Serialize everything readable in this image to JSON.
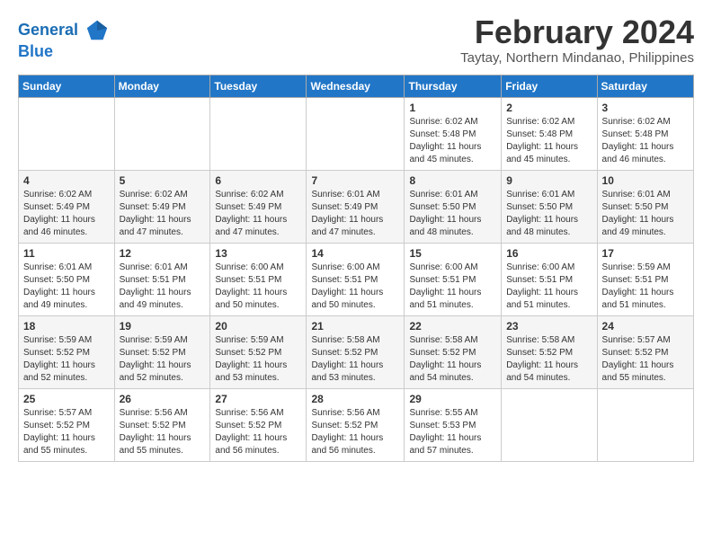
{
  "header": {
    "logo_line1": "General",
    "logo_line2": "Blue",
    "month_title": "February 2024",
    "location": "Taytay, Northern Mindanao, Philippines"
  },
  "days_of_week": [
    "Sunday",
    "Monday",
    "Tuesday",
    "Wednesday",
    "Thursday",
    "Friday",
    "Saturday"
  ],
  "weeks": [
    [
      {
        "day": "",
        "sunrise": "",
        "sunset": "",
        "daylight": ""
      },
      {
        "day": "",
        "sunrise": "",
        "sunset": "",
        "daylight": ""
      },
      {
        "day": "",
        "sunrise": "",
        "sunset": "",
        "daylight": ""
      },
      {
        "day": "",
        "sunrise": "",
        "sunset": "",
        "daylight": ""
      },
      {
        "day": "1",
        "sunrise": "Sunrise: 6:02 AM",
        "sunset": "Sunset: 5:48 PM",
        "daylight": "Daylight: 11 hours and 45 minutes."
      },
      {
        "day": "2",
        "sunrise": "Sunrise: 6:02 AM",
        "sunset": "Sunset: 5:48 PM",
        "daylight": "Daylight: 11 hours and 45 minutes."
      },
      {
        "day": "3",
        "sunrise": "Sunrise: 6:02 AM",
        "sunset": "Sunset: 5:48 PM",
        "daylight": "Daylight: 11 hours and 46 minutes."
      }
    ],
    [
      {
        "day": "4",
        "sunrise": "Sunrise: 6:02 AM",
        "sunset": "Sunset: 5:49 PM",
        "daylight": "Daylight: 11 hours and 46 minutes."
      },
      {
        "day": "5",
        "sunrise": "Sunrise: 6:02 AM",
        "sunset": "Sunset: 5:49 PM",
        "daylight": "Daylight: 11 hours and 47 minutes."
      },
      {
        "day": "6",
        "sunrise": "Sunrise: 6:02 AM",
        "sunset": "Sunset: 5:49 PM",
        "daylight": "Daylight: 11 hours and 47 minutes."
      },
      {
        "day": "7",
        "sunrise": "Sunrise: 6:01 AM",
        "sunset": "Sunset: 5:49 PM",
        "daylight": "Daylight: 11 hours and 47 minutes."
      },
      {
        "day": "8",
        "sunrise": "Sunrise: 6:01 AM",
        "sunset": "Sunset: 5:50 PM",
        "daylight": "Daylight: 11 hours and 48 minutes."
      },
      {
        "day": "9",
        "sunrise": "Sunrise: 6:01 AM",
        "sunset": "Sunset: 5:50 PM",
        "daylight": "Daylight: 11 hours and 48 minutes."
      },
      {
        "day": "10",
        "sunrise": "Sunrise: 6:01 AM",
        "sunset": "Sunset: 5:50 PM",
        "daylight": "Daylight: 11 hours and 49 minutes."
      }
    ],
    [
      {
        "day": "11",
        "sunrise": "Sunrise: 6:01 AM",
        "sunset": "Sunset: 5:50 PM",
        "daylight": "Daylight: 11 hours and 49 minutes."
      },
      {
        "day": "12",
        "sunrise": "Sunrise: 6:01 AM",
        "sunset": "Sunset: 5:51 PM",
        "daylight": "Daylight: 11 hours and 49 minutes."
      },
      {
        "day": "13",
        "sunrise": "Sunrise: 6:00 AM",
        "sunset": "Sunset: 5:51 PM",
        "daylight": "Daylight: 11 hours and 50 minutes."
      },
      {
        "day": "14",
        "sunrise": "Sunrise: 6:00 AM",
        "sunset": "Sunset: 5:51 PM",
        "daylight": "Daylight: 11 hours and 50 minutes."
      },
      {
        "day": "15",
        "sunrise": "Sunrise: 6:00 AM",
        "sunset": "Sunset: 5:51 PM",
        "daylight": "Daylight: 11 hours and 51 minutes."
      },
      {
        "day": "16",
        "sunrise": "Sunrise: 6:00 AM",
        "sunset": "Sunset: 5:51 PM",
        "daylight": "Daylight: 11 hours and 51 minutes."
      },
      {
        "day": "17",
        "sunrise": "Sunrise: 5:59 AM",
        "sunset": "Sunset: 5:51 PM",
        "daylight": "Daylight: 11 hours and 51 minutes."
      }
    ],
    [
      {
        "day": "18",
        "sunrise": "Sunrise: 5:59 AM",
        "sunset": "Sunset: 5:52 PM",
        "daylight": "Daylight: 11 hours and 52 minutes."
      },
      {
        "day": "19",
        "sunrise": "Sunrise: 5:59 AM",
        "sunset": "Sunset: 5:52 PM",
        "daylight": "Daylight: 11 hours and 52 minutes."
      },
      {
        "day": "20",
        "sunrise": "Sunrise: 5:59 AM",
        "sunset": "Sunset: 5:52 PM",
        "daylight": "Daylight: 11 hours and 53 minutes."
      },
      {
        "day": "21",
        "sunrise": "Sunrise: 5:58 AM",
        "sunset": "Sunset: 5:52 PM",
        "daylight": "Daylight: 11 hours and 53 minutes."
      },
      {
        "day": "22",
        "sunrise": "Sunrise: 5:58 AM",
        "sunset": "Sunset: 5:52 PM",
        "daylight": "Daylight: 11 hours and 54 minutes."
      },
      {
        "day": "23",
        "sunrise": "Sunrise: 5:58 AM",
        "sunset": "Sunset: 5:52 PM",
        "daylight": "Daylight: 11 hours and 54 minutes."
      },
      {
        "day": "24",
        "sunrise": "Sunrise: 5:57 AM",
        "sunset": "Sunset: 5:52 PM",
        "daylight": "Daylight: 11 hours and 55 minutes."
      }
    ],
    [
      {
        "day": "25",
        "sunrise": "Sunrise: 5:57 AM",
        "sunset": "Sunset: 5:52 PM",
        "daylight": "Daylight: 11 hours and 55 minutes."
      },
      {
        "day": "26",
        "sunrise": "Sunrise: 5:56 AM",
        "sunset": "Sunset: 5:52 PM",
        "daylight": "Daylight: 11 hours and 55 minutes."
      },
      {
        "day": "27",
        "sunrise": "Sunrise: 5:56 AM",
        "sunset": "Sunset: 5:52 PM",
        "daylight": "Daylight: 11 hours and 56 minutes."
      },
      {
        "day": "28",
        "sunrise": "Sunrise: 5:56 AM",
        "sunset": "Sunset: 5:52 PM",
        "daylight": "Daylight: 11 hours and 56 minutes."
      },
      {
        "day": "29",
        "sunrise": "Sunrise: 5:55 AM",
        "sunset": "Sunset: 5:53 PM",
        "daylight": "Daylight: 11 hours and 57 minutes."
      },
      {
        "day": "",
        "sunrise": "",
        "sunset": "",
        "daylight": ""
      },
      {
        "day": "",
        "sunrise": "",
        "sunset": "",
        "daylight": ""
      }
    ]
  ]
}
